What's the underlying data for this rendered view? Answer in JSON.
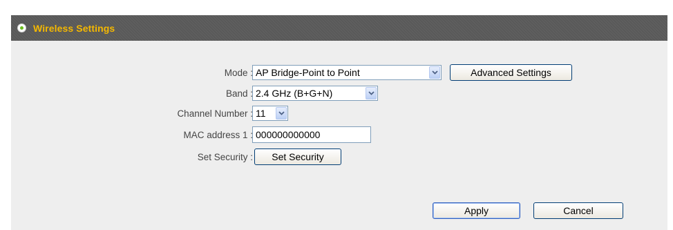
{
  "header": {
    "title": "Wireless Settings"
  },
  "form": {
    "mode": {
      "label": "Mode :",
      "value": "AP Bridge-Point to Point"
    },
    "advanced_button": "Advanced Settings",
    "band": {
      "label": "Band :",
      "value": "2.4 GHz (B+G+N)"
    },
    "channel": {
      "label": "Channel Number :",
      "value": "11"
    },
    "mac1": {
      "label": "MAC address 1 :",
      "value": "000000000000"
    },
    "security": {
      "label": "Set Security :",
      "button": "Set Security"
    }
  },
  "footer": {
    "apply": "Apply",
    "cancel": "Cancel"
  },
  "colors": {
    "header_bg": "#595959",
    "header_title": "#f5b800",
    "panel_bg": "#eeeeee",
    "radio_accent": "#6bbd1f"
  },
  "icons": {
    "section": "radio-dot-icon",
    "dropdown": "chevron-down-icon"
  }
}
